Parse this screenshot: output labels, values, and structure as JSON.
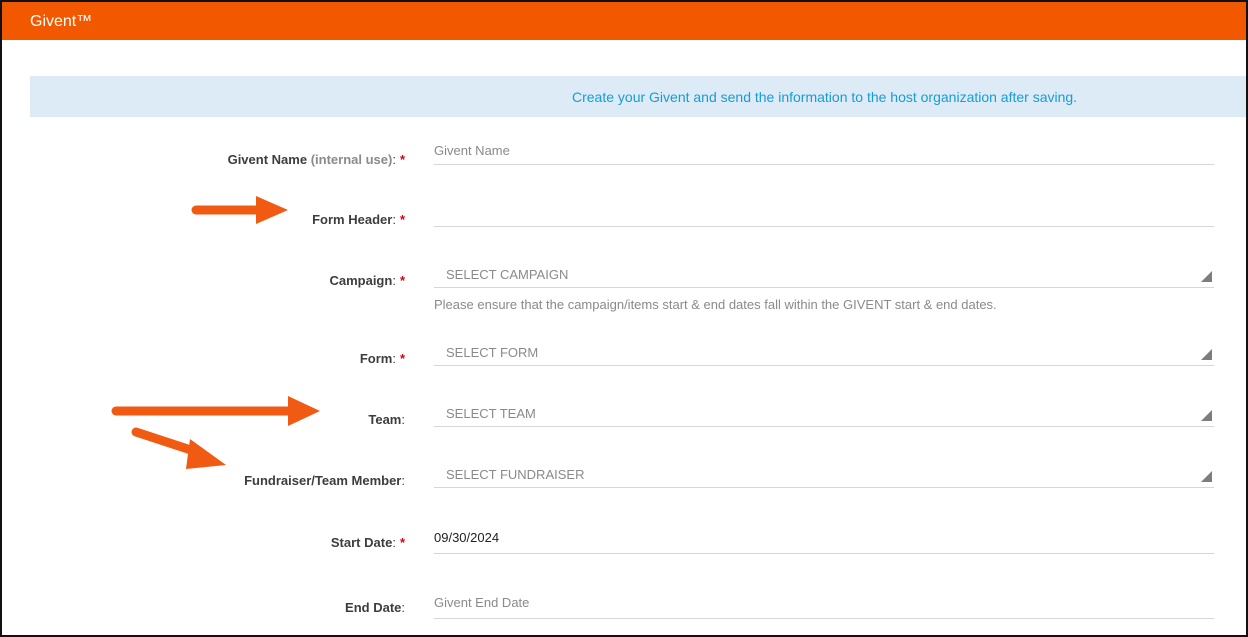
{
  "header": {
    "title": "Givent™"
  },
  "banner": {
    "text": "Create your Givent and send the information to the host organization after saving."
  },
  "form": {
    "givent_name": {
      "label": "Givent Name",
      "label_note": "(internal use)",
      "placeholder": "Givent Name",
      "required": "*"
    },
    "form_header": {
      "label": "Form Header",
      "value": "",
      "required": "*"
    },
    "campaign": {
      "label": "Campaign",
      "selected": "SELECT CAMPAIGN",
      "required": "*",
      "hint": "Please ensure that the campaign/items start & end dates fall within the GIVENT start & end dates."
    },
    "form_select": {
      "label": "Form",
      "selected": "SELECT FORM",
      "required": "*"
    },
    "team": {
      "label": "Team",
      "selected": "SELECT TEAM"
    },
    "fundraiser": {
      "label": "Fundraiser/Team Member",
      "selected": "SELECT FUNDRAISER"
    },
    "start_date": {
      "label": "Start Date",
      "value": "09/30/2024",
      "required": "*"
    },
    "end_date": {
      "label": "End Date",
      "placeholder": "Givent End Date"
    }
  },
  "colors": {
    "brand": "#f25800",
    "banner_bg": "#dcebf5",
    "banner_text": "#1a9bd7",
    "required": "#d0021b",
    "annotation_arrow": "#f05a13"
  },
  "icons": {
    "select_caret": "triangle-corner-icon",
    "annotation": "arrow-icon"
  }
}
